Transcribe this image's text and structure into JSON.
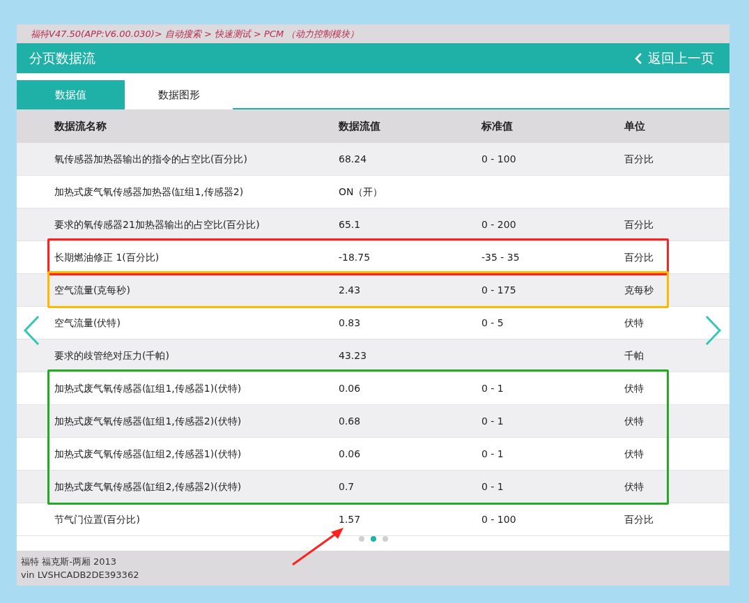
{
  "breadcrumb": "福特V47.50(APP:V6.00.030)> 自动搜索 > 快速测试 > PCM （动力控制模块）",
  "header": {
    "title": "分页数据流",
    "back": "返回上一页"
  },
  "tabs": [
    {
      "label": "数据值",
      "selected": true
    },
    {
      "label": "数据图形",
      "selected": false
    }
  ],
  "table": {
    "columns": [
      "数据流名称",
      "数据流值",
      "标准值",
      "单位"
    ],
    "rows": [
      {
        "cells": [
          "氧传感器加热器输出的指令的占空比(百分比)",
          "68.24",
          "0 - 100",
          "百分比"
        ]
      },
      {
        "cells": [
          "加热式废气氧传感器加热器(缸组1,传感器2)",
          "ON（开）",
          "",
          ""
        ]
      },
      {
        "cells": [
          "要求的氧传感器21加热器输出的占空比(百分比)",
          "65.1",
          "0 - 200",
          "百分比"
        ]
      },
      {
        "cells": [
          "长期燃油修正 1(百分比)",
          "-18.75",
          "-35 - 35",
          "百分比"
        ],
        "color": "#ff2020"
      },
      {
        "cells": [
          "空气流量(克每秒)",
          "2.43",
          "0 - 175",
          "克每秒"
        ],
        "color": "#ffb800"
      },
      {
        "cells": [
          "空气流量(伏特)",
          "0.83",
          "0 - 5",
          "伏特"
        ]
      },
      {
        "cells": [
          "要求的歧管绝对压力(千帕)",
          "43.23",
          "",
          "千帕"
        ]
      },
      {
        "cells": [
          "加热式废气氧传感器(缸组1,传感器1)(伏特)",
          "0.06",
          "0 - 1",
          "伏特"
        ],
        "color": "#22aa22"
      },
      {
        "cells": [
          "加热式废气氧传感器(缸组1,传感器2)(伏特)",
          "0.68",
          "0 - 1",
          "伏特"
        ],
        "color": "#22aa22"
      },
      {
        "cells": [
          "加热式废气氧传感器(缸组2,传感器1)(伏特)",
          "0.06",
          "0 - 1",
          "伏特"
        ],
        "color": "#22aa22"
      },
      {
        "cells": [
          "加热式废气氧传感器(缸组2,传感器2)(伏特)",
          "0.7",
          "0 - 1",
          "伏特"
        ],
        "color": "#22aa22"
      },
      {
        "cells": [
          "节气门位置(百分比)",
          "1.57",
          "0 - 100",
          "百分比"
        ],
        "pointer": true
      }
    ]
  },
  "pager": [
    {
      "selected": false
    },
    {
      "selected": true
    },
    {
      "selected": false
    }
  ],
  "footer": {
    "vehicle": "福特 福克斯-两厢 2013",
    "vin": "vin LVSHCADB2DE393362"
  }
}
